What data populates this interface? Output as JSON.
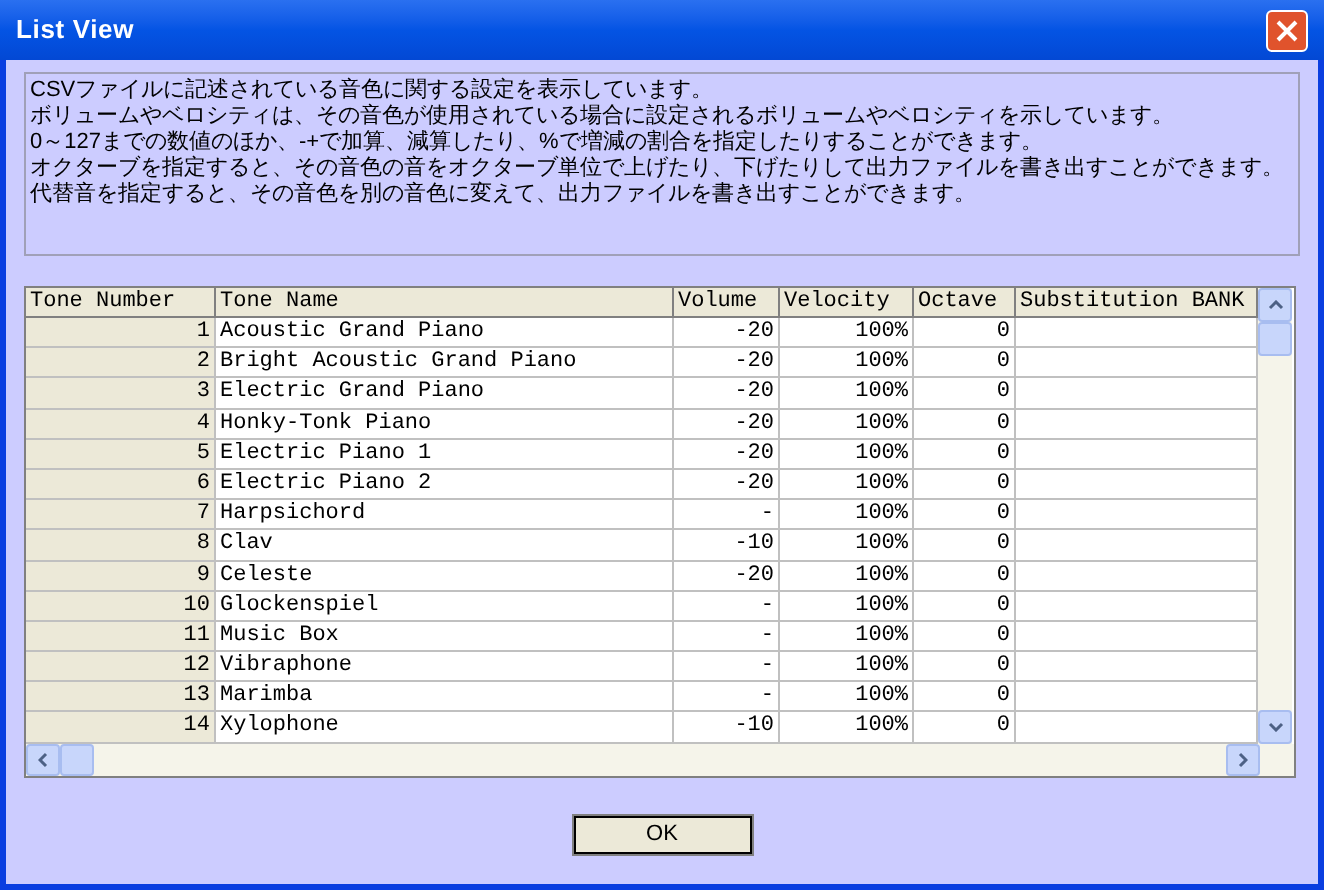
{
  "window": {
    "title": "List View"
  },
  "description": [
    "CSVファイルに記述されている音色に関する設定を表示しています。",
    "ボリュームやベロシティは、その音色が使用されている場合に設定されるボリュームやベロシティを示しています。",
    "0～127までの数値のほか、-+で加算、減算したり、%で増減の割合を指定したりすることができます。",
    "オクターブを指定すると、その音色の音をオクターブ単位で上げたり、下げたりして出力ファイルを書き出すことができます。",
    "代替音を指定すると、その音色を別の音色に変えて、出力ファイルを書き出すことができます。"
  ],
  "table": {
    "columns": [
      "Tone Number",
      "Tone Name",
      "Volume",
      "Velocity",
      "Octave",
      "Substitution BANK"
    ],
    "rows": [
      [
        "1",
        "Acoustic Grand Piano",
        "-20",
        "100%",
        "0"
      ],
      [
        "2",
        "Bright Acoustic Grand Piano",
        "-20",
        "100%",
        "0"
      ],
      [
        "3",
        "Electric Grand Piano",
        "-20",
        "100%",
        "0"
      ],
      [
        "4",
        "Honky-Tonk Piano",
        "-20",
        "100%",
        "0"
      ],
      [
        "5",
        "Electric Piano 1",
        "-20",
        "100%",
        "0"
      ],
      [
        "6",
        "Electric Piano 2",
        "-20",
        "100%",
        "0"
      ],
      [
        "7",
        "Harpsichord",
        "-",
        "100%",
        "0"
      ],
      [
        "8",
        "Clav",
        "-10",
        "100%",
        "0"
      ],
      [
        "9",
        "Celeste",
        "-20",
        "100%",
        "0"
      ],
      [
        "10",
        "Glockenspiel",
        "-",
        "100%",
        "0"
      ],
      [
        "11",
        "Music Box",
        "-",
        "100%",
        "0"
      ],
      [
        "12",
        "Vibraphone",
        "-",
        "100%",
        "0"
      ],
      [
        "13",
        "Marimba",
        "-",
        "100%",
        "0"
      ],
      [
        "14",
        "Xylophone",
        "-10",
        "100%",
        "0"
      ]
    ]
  },
  "buttons": [
    "OK"
  ]
}
